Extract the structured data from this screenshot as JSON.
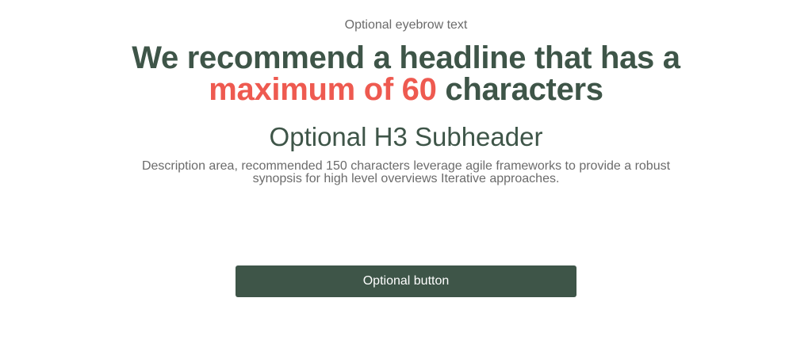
{
  "hero": {
    "eyebrow": "Optional eyebrow text",
    "headline": {
      "before": "We recommend a headline that has a ",
      "highlight": "maximum of 60",
      "after": " characters"
    },
    "subheader": "Optional H3 Subheader",
    "description": "Description area, recommended 150 characters leverage agile frameworks to provide a robust synopsis for high level overviews Iterative approaches.",
    "button_label": "Optional button"
  },
  "colors": {
    "headline": "#3e5548",
    "highlight": "#ee5a50",
    "body_text": "#6b6b6b",
    "button_bg": "#3e5548",
    "button_text": "#ffffff",
    "background": "#ffffff"
  }
}
